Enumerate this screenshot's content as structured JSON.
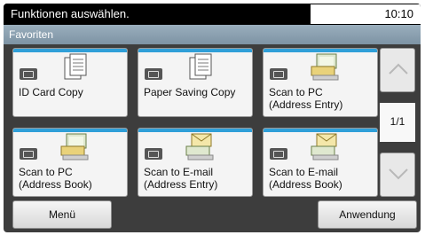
{
  "status": {
    "message": "Funktionen auswählen.",
    "time": "10:10"
  },
  "title": "Favoriten",
  "tiles": [
    {
      "label": "ID Card Copy",
      "icon": "copy-docs-icon",
      "badge": "copy-mode-icon"
    },
    {
      "label": "Paper Saving Copy",
      "icon": "copy-docs-icon",
      "badge": "copy-mode-icon"
    },
    {
      "label": "Scan to PC\n(Address Entry)",
      "icon": "scan-pc-icon",
      "badge": "scan-mode-icon"
    },
    {
      "label": "Scan to PC\n(Address Book)",
      "icon": "scan-pc-icon",
      "badge": "scan-mode-icon"
    },
    {
      "label": "Scan to E-mail\n(Address Entry)",
      "icon": "scan-email-icon",
      "badge": "scan-mode-icon"
    },
    {
      "label": "Scan to E-mail\n(Address Book)",
      "icon": "scan-email-icon",
      "badge": "scan-mode-icon"
    }
  ],
  "pager": {
    "label": "1/1"
  },
  "buttons": {
    "menu": "Menü",
    "apply": "Anwendung"
  },
  "colors": {
    "accent": "#2f9fd8",
    "status_bar": "#000000",
    "title_bar": "#8ea2b3"
  }
}
